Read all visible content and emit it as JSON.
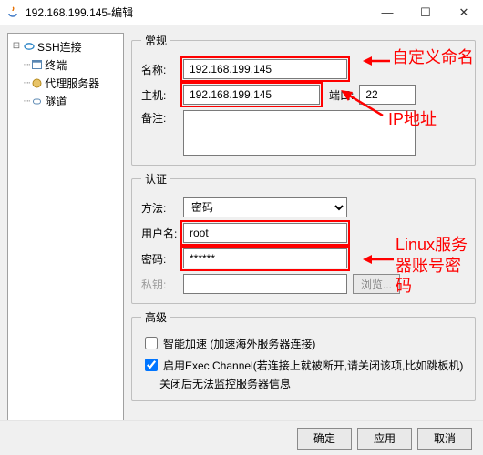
{
  "window": {
    "title": "192.168.199.145-编辑",
    "controls": {
      "min": "—",
      "max": "☐",
      "close": "✕"
    }
  },
  "tree": {
    "root": "SSH连接",
    "children": [
      "终端",
      "代理服务器",
      "隧道"
    ]
  },
  "general": {
    "legend": "常规",
    "name_label": "名称:",
    "name_value": "192.168.199.145",
    "host_label": "主机:",
    "host_value": "192.168.199.145",
    "port_label": "端口:",
    "port_value": "22",
    "remark_label": "备注:",
    "remark_value": ""
  },
  "auth": {
    "legend": "认证",
    "method_label": "方法:",
    "method_value": "密码",
    "user_label": "用户名:",
    "user_value": "root",
    "pass_label": "密码:",
    "pass_value": "******",
    "key_label": "私钥:",
    "key_value": "",
    "browse": "浏览..."
  },
  "advanced": {
    "legend": "高级",
    "smart_label": "智能加速 (加速海外服务器连接)",
    "smart_checked": false,
    "exec_label": "启用Exec Channel(若连接上就被断开,请关闭该项,比如跳板机)",
    "exec_checked": true,
    "exec_note": "关闭后无法监控服务器信息"
  },
  "buttons": {
    "ok": "确定",
    "apply": "应用",
    "cancel": "取消"
  },
  "annotations": {
    "a_name": "自定义命名",
    "a_ip": "IP地址",
    "a_cred": "Linux服务器账号密码"
  }
}
